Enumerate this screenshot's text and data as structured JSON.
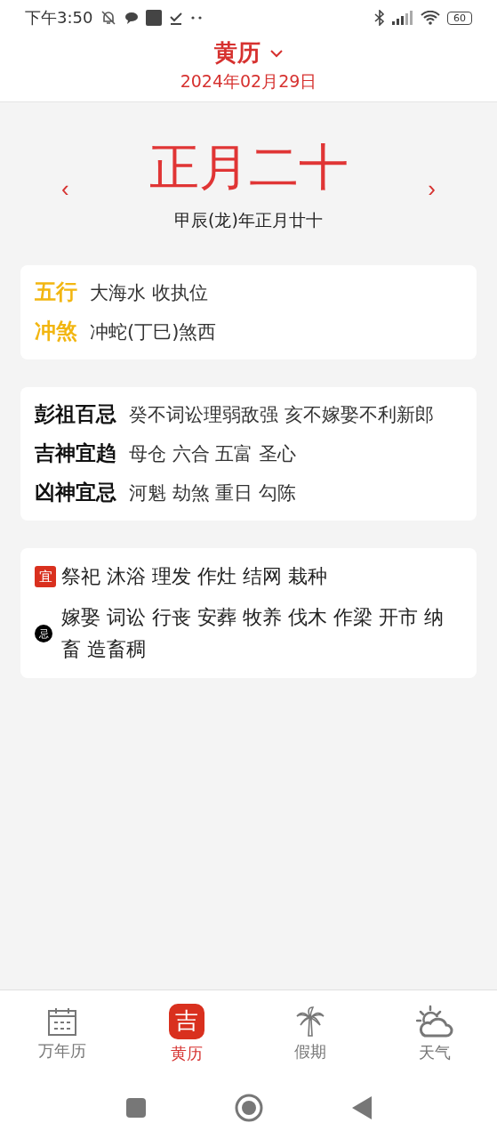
{
  "status_bar": {
    "time": "下午3:50",
    "battery": "60"
  },
  "header": {
    "title": "黄历",
    "date": "2024年02月29日"
  },
  "lunar": {
    "day": "正月二十",
    "full": "甲辰(龙)年正月廿十",
    "prev": "‹",
    "next": "›"
  },
  "elements": [
    {
      "label": "五行",
      "value": "大海水 收执位"
    },
    {
      "label": "冲煞",
      "value": "冲蛇(丁巳)煞西"
    }
  ],
  "spirits": [
    {
      "label": "彭祖百忌",
      "value": "癸不词讼理弱敌强 亥不嫁娶不利新郎"
    },
    {
      "label": "吉神宜趋",
      "value": "母仓 六合 五富 圣心"
    },
    {
      "label": "凶神宜忌",
      "value": "河魁 劫煞 重日 勾陈"
    }
  ],
  "activities": [
    {
      "kind": "good",
      "badge": "宜",
      "text": "祭祀 沐浴 理发 作灶 结网 栽种"
    },
    {
      "kind": "bad",
      "badge": "忌",
      "text": "嫁娶 词讼 行丧 安葬 牧养 伐木 作梁 开市 纳畜 造畜稠"
    }
  ],
  "tabs": [
    {
      "kind": "calendar",
      "label": "万年历",
      "selected": false
    },
    {
      "kind": "almanac",
      "label": "黄历",
      "selected": true,
      "glyph": "吉"
    },
    {
      "kind": "palm",
      "label": "假期",
      "selected": false
    },
    {
      "kind": "weather",
      "label": "天气",
      "selected": false
    }
  ]
}
